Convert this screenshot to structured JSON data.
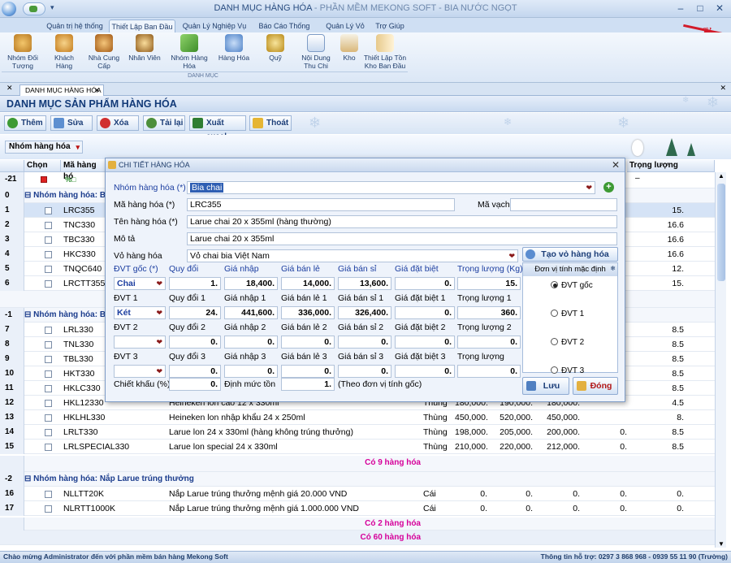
{
  "window": {
    "title": "DANH MỤC HÀNG HÓA",
    "subtitle": " - PHẦN MỀM MEKONG SOFT - BIA NƯỚC NGỌT"
  },
  "ribbon_tabs": [
    "Quản trị hệ thống",
    "Thiết Lập Ban Đầu",
    "Quản Lý Nghiệp Vụ",
    "Báo Cáo Thống Kê",
    "Quản Lý Vỏ",
    "Trợ Giúp"
  ],
  "ribbon_buttons": [
    "Nhóm Đối Tượng",
    "Khách Hàng",
    "Nhà Cung Cấp",
    "Nhân Viên",
    "Nhóm Hàng Hóa",
    "Hàng Hóa",
    "Quỹ",
    "Nội Dung Thu Chi",
    "Kho",
    "Thiết Lập Tồn Kho Ban Đầu"
  ],
  "ribbon_group": "DANH MỤC",
  "doc_tab": "DANH MỤC HÀNG HÓA",
  "panel_title": "DANH MỤC SẢN PHẨM HÀNG HÓA",
  "toolbar": {
    "add": "Thêm",
    "edit": "Sửa",
    "delete": "Xóa",
    "reload": "Tải lại",
    "export": "Xuất excel",
    "exit": "Thoát"
  },
  "filter_chip": "Nhóm hàng hóa",
  "grid": {
    "headers": {
      "select": "Chọn",
      "code": "Mã hàng hó",
      "weight": "Trọng lượng"
    },
    "filter_row_label": "-21",
    "groups": [
      {
        "label": "Nhóm hàng hóa: B",
        "row_label": "0"
      },
      {
        "label": "Nhóm hàng hóa: B",
        "row_label": "-1"
      },
      {
        "label": "Nhóm hàng hóa: Nắp Larue trúng thưởng",
        "row_label": "-2"
      }
    ],
    "rows_g0": [
      {
        "n": "1",
        "code": "LRC355",
        "w": "15."
      },
      {
        "n": "2",
        "code": "TNC330",
        "w": "16.6"
      },
      {
        "n": "3",
        "code": "TBC330",
        "w": "16.6"
      },
      {
        "n": "4",
        "code": "HKC330",
        "w": "16.6"
      },
      {
        "n": "5",
        "code": "TNQC640",
        "w": "12."
      },
      {
        "n": "6",
        "code": "LRCTT355",
        "w": "15."
      }
    ],
    "rows_g1": [
      {
        "n": "7",
        "code": "LRL330",
        "w": "8.5"
      },
      {
        "n": "8",
        "code": "TNL330",
        "w": "8.5"
      },
      {
        "n": "9",
        "code": "TBL330",
        "w": "8.5"
      },
      {
        "n": "10",
        "code": "HKT330",
        "w": "8.5"
      },
      {
        "n": "11",
        "code": "HKLC330",
        "w": "8.5"
      },
      {
        "n": "12",
        "code": "HKL12330",
        "name": "Heineken lon cao 12 x 330ml",
        "unit": "Thùng",
        "p1": "180,000.",
        "p2": "190,000.",
        "p3": "180,000.",
        "p4": "",
        "w": "4.5"
      },
      {
        "n": "13",
        "code": "HKLHL330",
        "name": "Heineken lon nhập khẩu 24 x 250ml",
        "unit": "Thùng",
        "p1": "450,000.",
        "p2": "520,000.",
        "p3": "450,000.",
        "p4": "",
        "w": "8."
      },
      {
        "n": "14",
        "code": "LRLT330",
        "name": "Larue lon 24 x 330ml (hàng không trúng thưởng)",
        "unit": "Thùng",
        "p1": "198,000.",
        "p2": "205,000.",
        "p3": "200,000.",
        "p4": "0.",
        "w": "8.5"
      },
      {
        "n": "15",
        "code": "LRLSPECIAL330",
        "name": "Larue lon special 24 x 330ml",
        "unit": "Thùng",
        "p1": "210,000.",
        "p2": "220,000.",
        "p3": "212,000.",
        "p4": "0.",
        "w": "8.5"
      }
    ],
    "rows_g2": [
      {
        "n": "16",
        "code": "NLLTT20K",
        "name": "Nắp Larue trúng thưởng mệnh giá 20.000 VND",
        "unit": "Cái",
        "p1": "0.",
        "p2": "0.",
        "p3": "0.",
        "p4": "0.",
        "w": "0."
      },
      {
        "n": "17",
        "code": "NLRTT1000K",
        "name": "Nắp Larue trúng thưởng mệnh giá 1.000.000 VND",
        "unit": "Cái",
        "p1": "0.",
        "p2": "0.",
        "p3": "0.",
        "p4": "0.",
        "w": "0."
      }
    ],
    "group_totals": [
      "Có 9 hàng hóa",
      "Có 2 hàng hóa"
    ],
    "grand_total": "Có 60 hàng hóa"
  },
  "dialog": {
    "title": "CHI TIẾT HÀNG HÓA",
    "group_label": "Nhóm hàng hóa (*)",
    "group_value": "Bia chai",
    "code_label": "Mã hàng hóa (*)",
    "code_value": "LRC355",
    "barcode_label": "Mã vạch",
    "barcode_value": "",
    "name_label": "Tên hàng hóa (*)",
    "name_value": "Larue chai 20 x 355ml (hàng thường)",
    "desc_label": "Mô tả",
    "desc_value": "Larue chai 20 x 355ml",
    "shell_label": "Vỏ hàng hóa",
    "shell_value": "Vỏ chai bia Việt Nam",
    "create_shell": "Tạo vỏ hàng hóa",
    "unit_rows": [
      {
        "labels": [
          "ĐVT gốc (*)",
          "Quy đổi",
          "Giá nhập",
          "Giá bán lẻ",
          "Giá bán sỉ",
          "Giá đặt biệt",
          "Trọng lượng (Kg)"
        ],
        "values": [
          "Chai",
          "1.",
          "18,400.",
          "14,000.",
          "13,600.",
          "0.",
          "15."
        ]
      },
      {
        "labels": [
          "ĐVT 1",
          "Quy đổi  1",
          "Giá nhập 1",
          "Giá bán lẻ 1",
          "Giá bán sỉ 1",
          "Giá đặt biệt 1",
          "Trọng lượng 1"
        ],
        "values": [
          "Két",
          "24.",
          "441,600.",
          "336,000.",
          "326,400.",
          "0.",
          "360."
        ]
      },
      {
        "labels": [
          "ĐVT 2",
          "Quy đổi 2",
          "Giá nhập 2",
          "Giá bán lẻ 2",
          "Giá bán sỉ 2",
          "Giá đặt biệt 2",
          "Trọng lượng 2"
        ],
        "values": [
          "",
          "0.",
          "0.",
          "0.",
          "0.",
          "0.",
          "0."
        ]
      },
      {
        "labels": [
          "ĐVT 3",
          "Quy đổi 3",
          "Giá nhập 3",
          "Giá bán lẻ 3",
          "Giá bán sỉ 3",
          "Giá đặt biệt 3",
          "Trọng lượng"
        ],
        "values": [
          "",
          "0.",
          "0.",
          "0.",
          "0.",
          "0.",
          "0."
        ]
      }
    ],
    "discount_label": "Chiết khấu (%)",
    "discount_value": "0.",
    "stock_label": "Định mức tồn",
    "stock_value": "1.",
    "stock_note": "(Theo đơn vị tính gốc)",
    "default_unit_title": "Đơn vị tính mặc định",
    "default_units": [
      "ĐVT gốc",
      "ĐVT 1",
      "ĐVT 2",
      "ĐVT 3"
    ],
    "save": "Lưu",
    "close": "Đóng"
  },
  "status": {
    "left": "Chào mừng Administrator đến với phần mềm bán hàng Mekong Soft",
    "right": "Thông tin hỗ trợ: 0297 3 868 968 - 0939 55 11 90 (Trường)"
  }
}
